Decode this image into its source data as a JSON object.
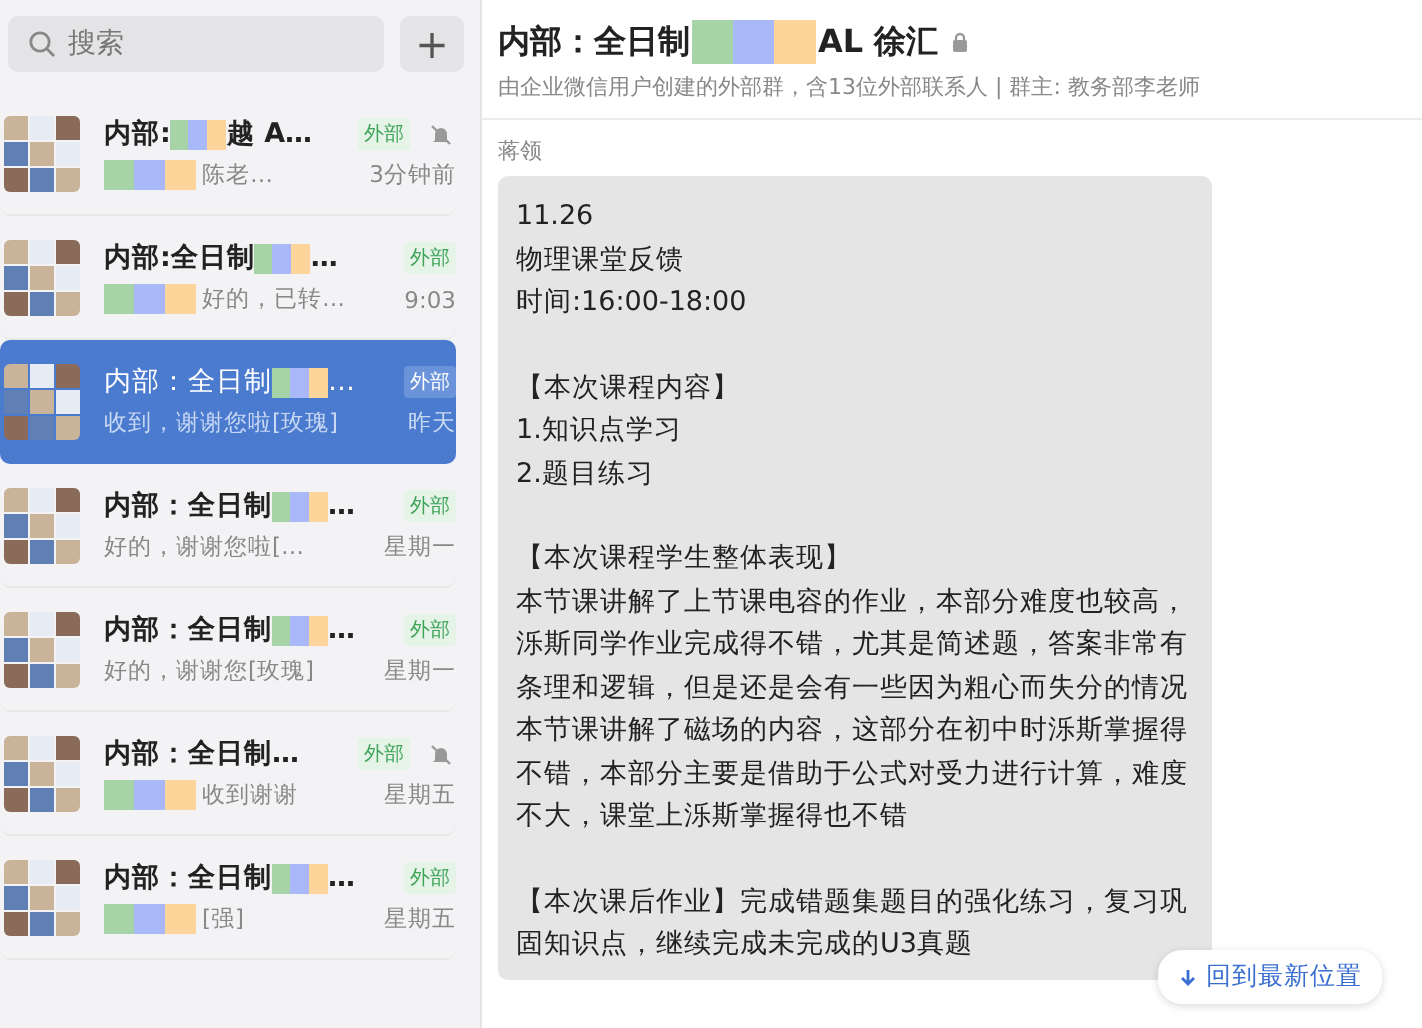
{
  "sidebar": {
    "search": {
      "placeholder": "搜索"
    },
    "add_button": "+",
    "chats": [
      {
        "name": "内部:",
        "name_redacted": true,
        "name_tail": "越 A…",
        "tag": "外部",
        "muted": true,
        "preview_redacted": true,
        "preview": "陈老…",
        "time": "3分钟前",
        "selected": false
      },
      {
        "name": "内部:全日制",
        "name_redacted": true,
        "name_tail": "…",
        "tag": "外部",
        "muted": false,
        "preview_redacted": true,
        "preview": "好的，已转…",
        "time": "9:03",
        "selected": false
      },
      {
        "name": "内部：全日制",
        "name_redacted": true,
        "name_tail": "…",
        "tag": "外部",
        "muted": false,
        "preview_redacted": false,
        "preview": "收到，谢谢您啦[玫瑰]",
        "time": "昨天",
        "selected": true
      },
      {
        "name": "内部：全日制",
        "name_redacted": true,
        "name_tail": "…",
        "tag": "外部",
        "muted": false,
        "preview_redacted": false,
        "preview": "好的，谢谢您啦[…",
        "time": "星期一",
        "selected": false
      },
      {
        "name": "内部：全日制",
        "name_redacted": true,
        "name_tail": "…",
        "tag": "外部",
        "muted": false,
        "preview_redacted": false,
        "preview": "好的，谢谢您[玫瑰]",
        "time": "星期一",
        "selected": false
      },
      {
        "name": "内部：全日制…",
        "name_redacted": false,
        "tag": "外部",
        "muted": true,
        "preview_redacted": true,
        "preview": "收到谢谢",
        "time": "星期五",
        "selected": false
      },
      {
        "name": "内部：全日制",
        "name_redacted": true,
        "name_tail": "…",
        "tag": "外部",
        "muted": false,
        "preview_redacted": true,
        "preview": "[强]",
        "time": "星期五",
        "selected": false
      }
    ]
  },
  "chat": {
    "title": "内部：全日制",
    "title_redacted": true,
    "title_tail": "AL 徐汇",
    "locked": true,
    "subtitle": "由企业微信用户创建的外部群，含13位外部联系人 | 群主: 教务部李老师",
    "message": {
      "sender": "蒋领",
      "paragraphs": [
        [
          "11.26",
          "物理课堂反馈",
          "时间:16:00-18:00"
        ],
        [
          "【本次课程内容】",
          "1.知识点学习",
          "2.题目练习"
        ],
        [
          "【本次课程学生整体表现】",
          "本节课讲解了上节课电容的作业，本部分难度也较高，泺斯同学作业完成得不错，尤其是简述题，答案非常有条理和逻辑，但是还是会有一些因为粗心而失分的情况",
          "本节课讲解了磁场的内容，这部分在初中时泺斯掌握得不错，本部分主要是借助于公式对受力进行计算，难度不大，课堂上泺斯掌握得也不错"
        ],
        [
          "【本次课后作业】完成错题集题目的强化练习，复习巩固知识点，继续完成未完成的U3真题"
        ]
      ]
    },
    "jump_button": "回到最新位置"
  }
}
